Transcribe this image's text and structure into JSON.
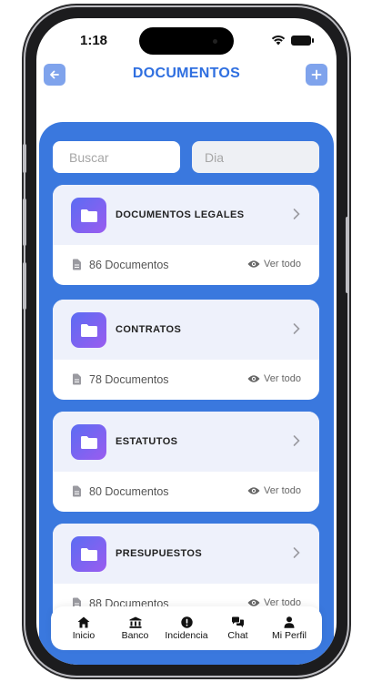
{
  "status_bar": {
    "time": "1:18"
  },
  "header": {
    "title": "DOCUMENTOS"
  },
  "filters": {
    "search_placeholder": "Buscar",
    "day_placeholder": "Dia"
  },
  "categories": [
    {
      "title": "DOCUMENTOS LEGALES",
      "count": "86 Documentos",
      "action": "Ver todo"
    },
    {
      "title": "CONTRATOS",
      "count": "78 Documentos",
      "action": "Ver todo"
    },
    {
      "title": "ESTATUTOS",
      "count": "80 Documentos",
      "action": "Ver todo"
    },
    {
      "title": "PRESUPUESTOS",
      "count": "88 Documentos",
      "action": "Ver todo"
    }
  ],
  "tab_bar": [
    {
      "label": "Inicio",
      "icon": "home-icon"
    },
    {
      "label": "Banco",
      "icon": "bank-icon"
    },
    {
      "label": "Incidencia",
      "icon": "alert-icon"
    },
    {
      "label": "Chat",
      "icon": "chat-icon"
    },
    {
      "label": "Mi Perfil",
      "icon": "user-icon"
    }
  ],
  "colors": {
    "accent": "#3a78de",
    "title": "#2f6fe0",
    "header_button": "#7fa3ec",
    "card_top": "#eef1fb"
  }
}
